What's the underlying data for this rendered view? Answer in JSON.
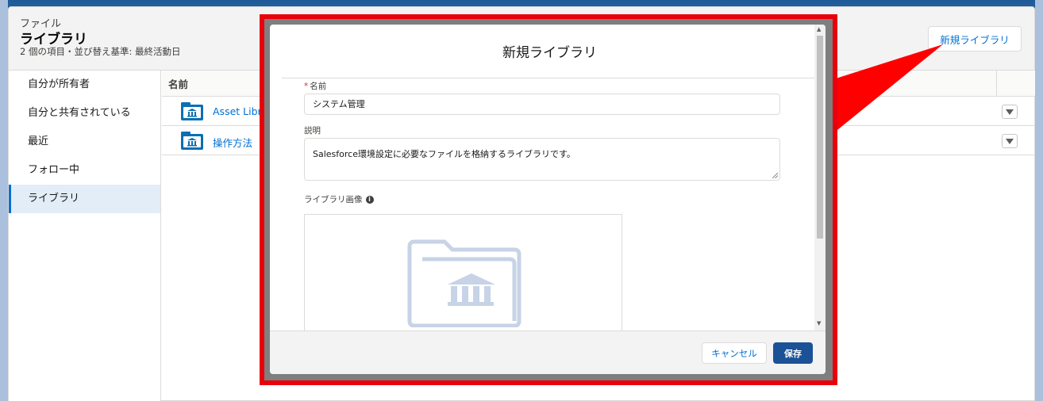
{
  "header": {
    "object_label": "ファイル",
    "title": "ライブラリ",
    "meta": "2 個の項目・並び替え基準: 最終活動日",
    "new_library_button": "新規ライブラリ"
  },
  "sidebar": {
    "items": [
      {
        "label": "自分が所有者"
      },
      {
        "label": "自分と共有されている"
      },
      {
        "label": "最近"
      },
      {
        "label": "フォロー中"
      },
      {
        "label": "ライブラリ"
      }
    ],
    "active_index": 4
  },
  "table": {
    "column_name": "名前",
    "rows": [
      {
        "name": "Asset Libra"
      },
      {
        "name": "操作方法"
      }
    ]
  },
  "modal": {
    "title": "新規ライブラリ",
    "name_label": "名前",
    "name_required_mark": "*",
    "name_value": "システム管理",
    "description_label": "説明",
    "description_value": "Salesforce環境設定に必要なファイルを格納するライブラリです。",
    "image_label": "ライブラリ画像",
    "cancel_button": "キャンセル",
    "save_button": "保存"
  },
  "colors": {
    "brand_blue": "#0070d2",
    "save_button": "#1b5297",
    "callout_red": "#e8000b"
  },
  "icons": [
    "folder-library-icon",
    "chevron-down-icon",
    "info-icon",
    "library-placeholder-icon"
  ]
}
